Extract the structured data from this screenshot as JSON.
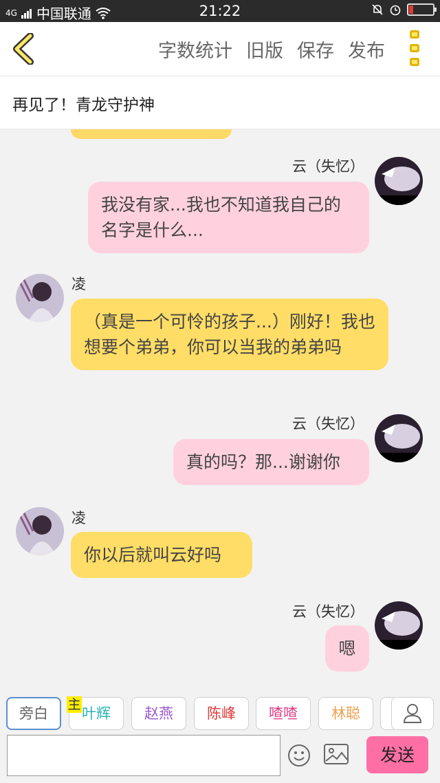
{
  "status_bar": {
    "network": "4G",
    "carrier": "中国联通",
    "time": "21:22"
  },
  "toolbar": {
    "word_count": "字数统计",
    "old_version": "旧版",
    "save": "保存",
    "publish": "发布"
  },
  "story_title": "再见了！青龙守护神",
  "messages": [
    {
      "sender": "云（失忆）",
      "side": "right",
      "text": "我没有家...我也不知道我自己的名字是什么..."
    },
    {
      "sender": "凌",
      "side": "left",
      "text": "（真是一个可怜的孩子...）刚好！我也想要个弟弟，你可以当我的弟弟吗"
    },
    {
      "sender": "云（失忆）",
      "side": "right",
      "text": "真的吗？那...谢谢你"
    },
    {
      "sender": "凌",
      "side": "left",
      "text": "你以后就叫云好吗"
    },
    {
      "sender": "云（失忆）",
      "side": "right",
      "text": "嗯"
    }
  ],
  "roles": [
    {
      "label": "旁白",
      "color": "#666666"
    },
    {
      "label": "叶辉",
      "color": "#2bb3b3",
      "main_tag": "主"
    },
    {
      "label": "赵燕",
      "color": "#9b59d0"
    },
    {
      "label": "陈峰",
      "color": "#e03c3c"
    },
    {
      "label": "喳喳",
      "color": "#e0408a"
    },
    {
      "label": "林聪",
      "color": "#f0a050"
    }
  ],
  "input": {
    "value": "",
    "send_label": "发送"
  },
  "colors": {
    "pink_bubble": "#ffd1df",
    "yellow_bubble": "#ffdd66",
    "send_button": "#ff6fa6",
    "accent": "#ffe866"
  }
}
